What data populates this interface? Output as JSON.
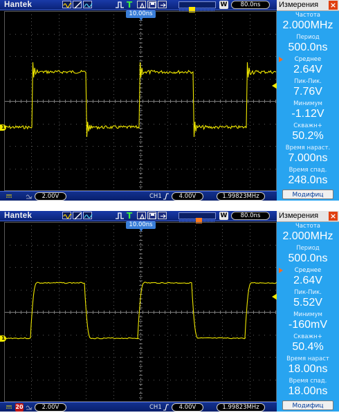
{
  "screenshots": [
    {
      "brand": "Hantek",
      "toolbar": {
        "timebase": "80.0ns",
        "w_label": "W",
        "trigger_label": "T"
      },
      "trigger_offset_label": "10.00ns",
      "channel_marker": "1",
      "status": {
        "bandwidth_limit_shown": false,
        "volts_div": "2.00V",
        "channel": "CH1",
        "trigger_level": "4.00V",
        "frequency": "1.99823MHz"
      },
      "panel": {
        "title": "Измерения",
        "close_icon": "×",
        "measurements": [
          {
            "label": "Частота",
            "value": "2.000MHz",
            "selected": false
          },
          {
            "label": "Период",
            "value": "500.0ns",
            "selected": false
          },
          {
            "label": "Среднее",
            "value": "2.64V",
            "selected": true
          },
          {
            "label": "Пик-Пик.",
            "value": "7.76V",
            "selected": false
          },
          {
            "label": "Минимум",
            "value": "-1.12V",
            "selected": false
          },
          {
            "label": "Скважн+",
            "value": "50.2%",
            "selected": false
          },
          {
            "label": "Время нараст.",
            "value": "7.000ns",
            "selected": false
          },
          {
            "label": "Время спад.",
            "value": "248.0ns",
            "selected": false
          }
        ],
        "button": "Модифиц"
      },
      "trace": {
        "style": "ringing",
        "color": "#f0e800"
      }
    },
    {
      "brand": "Hantek",
      "toolbar": {
        "timebase": "80.0ns",
        "w_label": "W",
        "trigger_label": "T"
      },
      "trigger_offset_label": "10.00ns",
      "channel_marker": "1",
      "status": {
        "bandwidth_limit_shown": true,
        "bandwidth_label": "20",
        "volts_div": "2.00V",
        "channel": "CH1",
        "trigger_level": "4.00V",
        "frequency": "1.99823MHz"
      },
      "panel": {
        "title": "Измерения",
        "close_icon": "×",
        "measurements": [
          {
            "label": "Частота",
            "value": "2.000MHz",
            "selected": false
          },
          {
            "label": "Период",
            "value": "500.0ns",
            "selected": false
          },
          {
            "label": "Среднее",
            "value": "2.64V",
            "selected": true
          },
          {
            "label": "Пик-Пик.",
            "value": "5.52V",
            "selected": false
          },
          {
            "label": "Минимум",
            "value": "-160mV",
            "selected": false
          },
          {
            "label": "Скважн+",
            "value": "50.4%",
            "selected": false
          },
          {
            "label": "Время нараст",
            "value": "18.00ns",
            "selected": false
          },
          {
            "label": "Время спад.",
            "value": "18.00ns",
            "selected": false
          }
        ],
        "button": "Модифиц"
      },
      "trace": {
        "style": "smooth",
        "color": "#f0e800"
      }
    }
  ]
}
